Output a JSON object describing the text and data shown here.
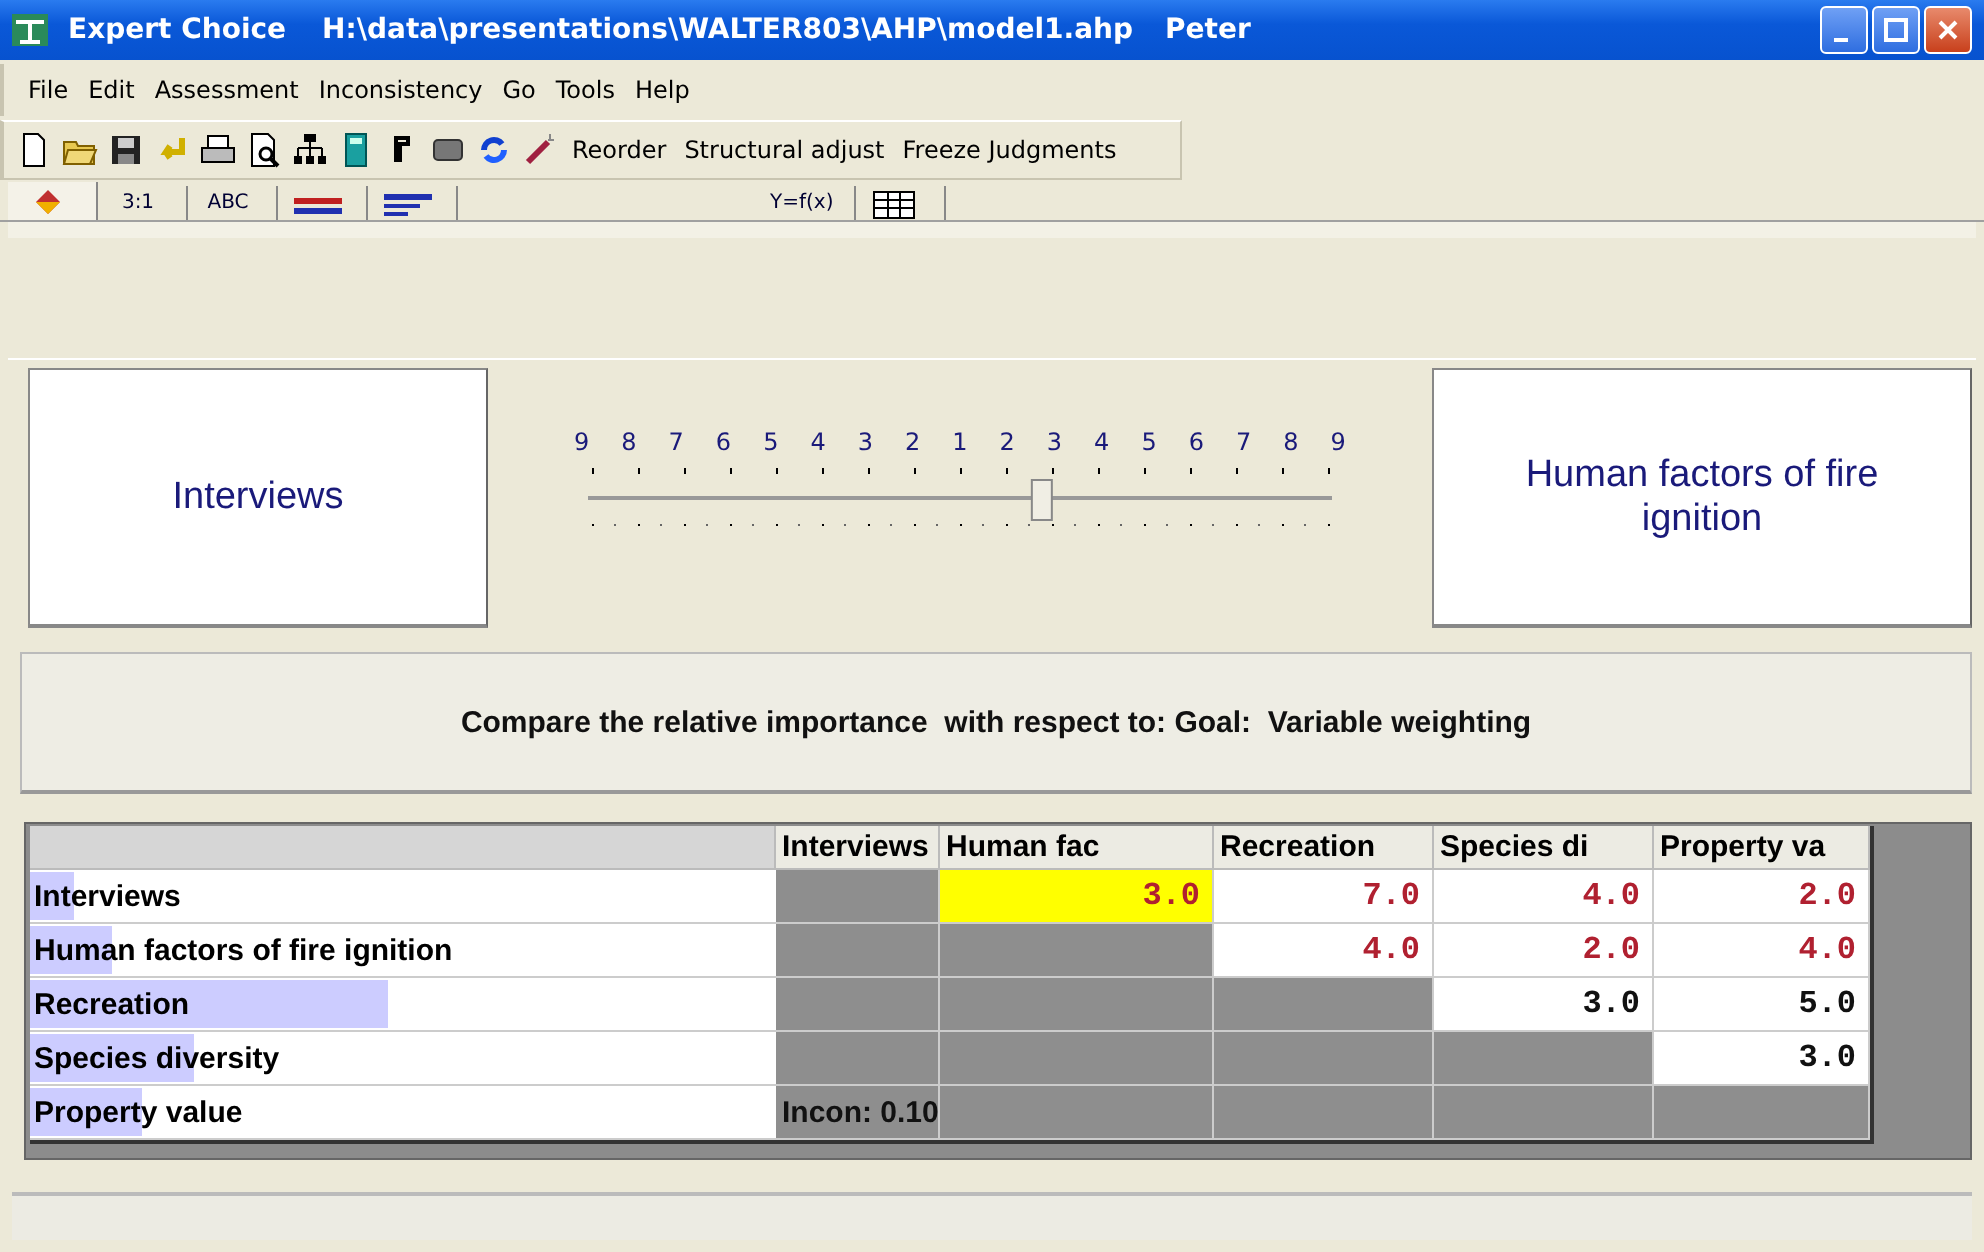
{
  "window": {
    "app": "Expert Choice",
    "path": "H:\\data\\presentations\\WALTER803\\AHP\\model1.ahp",
    "user": "Peter"
  },
  "menu": [
    "File",
    "Edit",
    "Assessment",
    "Inconsistency",
    "Go",
    "Tools",
    "Help"
  ],
  "toolbar": {
    "commands": [
      "Reorder",
      "Structural adjust",
      "Freeze Judgments"
    ]
  },
  "tabs": [
    {
      "kind": "icon",
      "selected": true
    },
    {
      "kind": "text",
      "label": "3:1",
      "selected": false
    },
    {
      "kind": "text",
      "label": "ABC",
      "selected": false
    },
    {
      "kind": "icon",
      "selected": false
    },
    {
      "kind": "icon",
      "selected": false
    },
    {
      "kind": "text",
      "label": "Y=f(x)",
      "selected": false
    },
    {
      "kind": "icon",
      "selected": false
    }
  ],
  "comparison": {
    "left": "Interviews",
    "right": "Human factors of fire ignition",
    "scale": [
      "9",
      "8",
      "7",
      "6",
      "5",
      "4",
      "3",
      "2",
      "1",
      "2",
      "3",
      "4",
      "5",
      "6",
      "7",
      "8",
      "9"
    ],
    "level": 0.61
  },
  "instruction": "Compare the relative importance  with respect to: Goal:  Variable weighting",
  "table": {
    "columns": [
      "Interviews",
      "Human fac",
      "Recreation",
      "Species di",
      "Property va"
    ],
    "rows": [
      {
        "label": "Interviews",
        "level": 0.06,
        "cells": [
          {
            "shaded": true
          },
          {
            "value": "3.0",
            "inverse": true,
            "selected": true
          },
          {
            "value": "7.0",
            "inverse": true
          },
          {
            "value": "4.0",
            "inverse": true
          },
          {
            "value": "2.0",
            "inverse": true
          }
        ]
      },
      {
        "label": "Human factors of fire ignition",
        "level": 0.11,
        "cells": [
          {
            "shaded": true
          },
          {
            "shaded": true
          },
          {
            "value": "4.0",
            "inverse": true
          },
          {
            "value": "2.0",
            "inverse": true
          },
          {
            "value": "4.0",
            "inverse": true
          }
        ]
      },
      {
        "label": "Recreation",
        "level": 0.48,
        "cells": [
          {
            "shaded": true
          },
          {
            "shaded": true
          },
          {
            "shaded": true
          },
          {
            "value": "3.0",
            "inverse": false
          },
          {
            "value": "5.0",
            "inverse": false
          }
        ]
      },
      {
        "label": "Species diversity",
        "level": 0.22,
        "cells": [
          {
            "shaded": true
          },
          {
            "shaded": true
          },
          {
            "shaded": true
          },
          {
            "shaded": true
          },
          {
            "value": "3.0",
            "inverse": false
          }
        ]
      },
      {
        "label": "Property value",
        "level": 0.15,
        "cells": [
          {
            "shaded": true,
            "value": "Incon: 0.10",
            "inverse": false
          },
          {
            "shaded": true
          },
          {
            "shaded": true
          },
          {
            "shaded": true
          },
          {
            "shaded": true
          }
        ]
      }
    ]
  }
}
